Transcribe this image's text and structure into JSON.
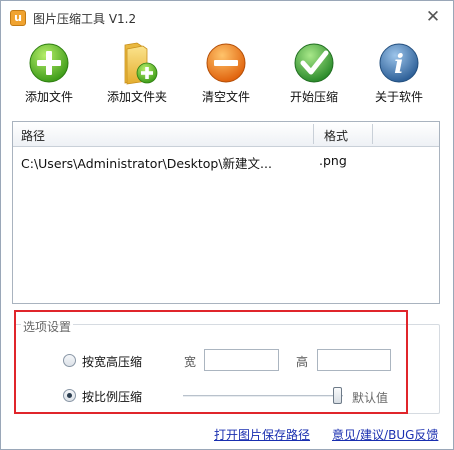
{
  "window": {
    "title": "图片压缩工具 V1.2",
    "icon_text": "u",
    "close_glyph": "✕"
  },
  "toolbar": {
    "items": [
      {
        "label": "添加文件",
        "icon": "add-file-icon",
        "color": "#5bbf2a"
      },
      {
        "label": "添加文件夹",
        "icon": "add-folder-icon",
        "color": "#f2c24a"
      },
      {
        "label": "清空文件",
        "icon": "clear-icon",
        "color": "#f07a16"
      },
      {
        "label": "开始压缩",
        "icon": "check-icon",
        "color": "#3da53b"
      },
      {
        "label": "关于软件",
        "icon": "info-icon",
        "color": "#3a6fa8"
      }
    ]
  },
  "file_list": {
    "columns": [
      "路径",
      "格式"
    ],
    "rows": [
      {
        "path": "C:\\Users\\Administrator\\Desktop\\新建文...",
        "format": ".png"
      }
    ]
  },
  "options": {
    "title": "选项设置",
    "by_size": {
      "label": "按宽高压缩",
      "checked": false
    },
    "width_label": "宽",
    "width_value": "",
    "height_label": "高",
    "height_value": "",
    "by_ratio": {
      "label": "按比例压缩",
      "checked": true
    },
    "slider_value_label": "默认值",
    "slider_level": 1.0
  },
  "footer": {
    "open_folder_link": "打开图片保存路径",
    "feedback_link": "意见/建议/BUG反馈"
  },
  "colors": {
    "highlight": "#e0252b",
    "link": "#1a2fb0"
  }
}
